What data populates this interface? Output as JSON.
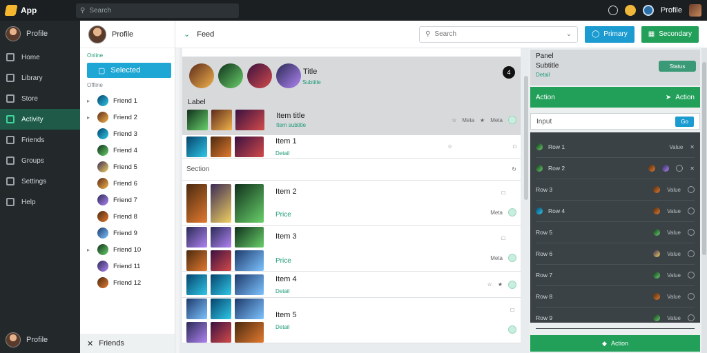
{
  "app": {
    "title": "App"
  },
  "search": {
    "placeholder": "Search"
  },
  "topbar": {
    "user_name": "Profile"
  },
  "nav": {
    "profile_name": "Profile",
    "items": [
      {
        "label": "Home"
      },
      {
        "label": "Library"
      },
      {
        "label": "Store"
      },
      {
        "label": "Activity"
      },
      {
        "label": "Friends"
      },
      {
        "label": "Groups"
      },
      {
        "label": "Settings"
      },
      {
        "label": "Help"
      }
    ],
    "bottom_label": "Profile"
  },
  "friends": {
    "header_name": "Profile",
    "section_online": "Online",
    "active_label": "Selected",
    "section_offline": "Offline",
    "rows": [
      {
        "label": "Friend 1"
      },
      {
        "label": "Friend 2"
      },
      {
        "label": "Friend 3"
      },
      {
        "label": "Friend 4"
      },
      {
        "label": "Friend 5"
      },
      {
        "label": "Friend 6"
      },
      {
        "label": "Friend 7"
      },
      {
        "label": "Friend 8"
      },
      {
        "label": "Friend 9"
      },
      {
        "label": "Friend 10"
      },
      {
        "label": "Friend 11"
      },
      {
        "label": "Friend 12"
      }
    ],
    "bottom_label": "Friends"
  },
  "main": {
    "section_label": "Feed",
    "select_placeholder": "Search",
    "btn_primary": "Primary",
    "btn_secondary": "Secondary"
  },
  "feed": {
    "hero_title": "Title",
    "hero_sub": "Subtitle",
    "hero_badge": "4",
    "hero_label": "Label",
    "hero_row_title": "Item title",
    "hero_row_sub": "Item subtitle",
    "hero_row_meta": "Meta",
    "hero_row_meta2": "Meta",
    "cards": [
      {
        "title": "Item 1",
        "sub": "Detail"
      },
      {
        "label": "Section"
      },
      {
        "title": "Item 2",
        "price": "Price"
      },
      {
        "title": "Item 3",
        "price": "Price"
      },
      {
        "title": "Item 4",
        "sub": "Detail"
      },
      {
        "title": "Item 5",
        "sub": "Detail"
      }
    ],
    "meta": "Meta"
  },
  "side": {
    "title": "Panel",
    "subtitle": "Subtitle",
    "detail": "Detail",
    "pill": "Status",
    "green_label": "Action",
    "green_right": "Action",
    "input_label": "Input",
    "input_btn": "Go",
    "rows": [
      {
        "label": "Row 1",
        "value": "Value"
      },
      {
        "label": "Row 2",
        "value": ""
      },
      {
        "label": "Row 3",
        "value": "Value"
      },
      {
        "label": "Row 4",
        "value": "Value"
      },
      {
        "label": "Row 5",
        "value": "Value"
      },
      {
        "label": "Row 6",
        "value": "Value"
      },
      {
        "label": "Row 7",
        "value": "Value"
      },
      {
        "label": "Row 8",
        "value": "Value"
      },
      {
        "label": "Row 9",
        "value": "Value"
      }
    ],
    "bottom_label": "Action"
  }
}
